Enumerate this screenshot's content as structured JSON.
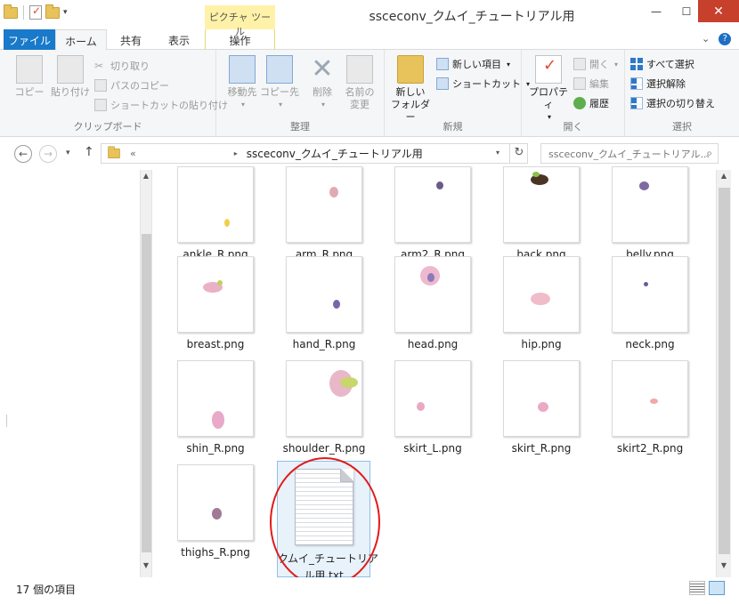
{
  "window": {
    "title": "ssceconv_クムイ_チュートリアル用",
    "context_tab_group": "ピクチャ ツール",
    "min_glyph": "—",
    "max_glyph": "☐",
    "close_glyph": "✕"
  },
  "tabs": {
    "file": "ファイル",
    "home": "ホーム",
    "share": "共有",
    "view": "表示",
    "manage": "操作",
    "expand_glyph": "⌄",
    "help_glyph": "?"
  },
  "ribbon": {
    "clipboard": {
      "label": "クリップボード",
      "copy": "コピー",
      "paste": "貼り付け",
      "cut": "切り取り",
      "copy_path": "パスのコピー",
      "paste_shortcut": "ショートカットの貼り付け"
    },
    "organize": {
      "label": "整理",
      "move_to": "移動先",
      "copy_to": "コピー先",
      "delete": "削除",
      "rename_line1": "名前の",
      "rename_line2": "変更"
    },
    "new": {
      "label": "新規",
      "new_folder_line1": "新しい",
      "new_folder_line2": "フォルダー",
      "new_item": "新しい項目",
      "shortcut": "ショートカット"
    },
    "open": {
      "label": "開く",
      "properties": "プロパティ",
      "open": "開く",
      "edit": "編集",
      "history": "履歴"
    },
    "select": {
      "label": "選択",
      "select_all": "すべて選択",
      "select_none": "選択解除",
      "invert_selection": "選択の切り替え"
    }
  },
  "address": {
    "chevron": "«",
    "path": "ssceconv_クムイ_チュートリアル用",
    "search_placeholder": "ssceconv_クムイ_チュートリアル...",
    "back_glyph": "←",
    "forward_glyph": "→",
    "up_glyph": "↑",
    "refresh_glyph": "↻",
    "search_glyph": "⌕"
  },
  "files": [
    {
      "name": "ankle_R.png"
    },
    {
      "name": "arm_R.png"
    },
    {
      "name": "arm2_R.png"
    },
    {
      "name": "back.png"
    },
    {
      "name": "belly.png"
    },
    {
      "name": "breast.png"
    },
    {
      "name": "hand_R.png"
    },
    {
      "name": "head.png"
    },
    {
      "name": "hip.png"
    },
    {
      "name": "neck.png"
    },
    {
      "name": "shin_R.png"
    },
    {
      "name": "shoulder_R.png"
    },
    {
      "name": "skirt_L.png"
    },
    {
      "name": "skirt_R.png"
    },
    {
      "name": "skirt2_R.png"
    },
    {
      "name": "thighs_R.png"
    },
    {
      "name_line1": "クムイ_チュートリア",
      "name_line2": "ル用.txt"
    }
  ],
  "status": {
    "item_count": "17 個の項目"
  },
  "colors": {
    "file_tab": "#1979ca",
    "context_tab": "#fff2a8",
    "close_button": "#c7402c",
    "highlight_circle": "#e21a1a",
    "selection": "#e8f2fb"
  }
}
